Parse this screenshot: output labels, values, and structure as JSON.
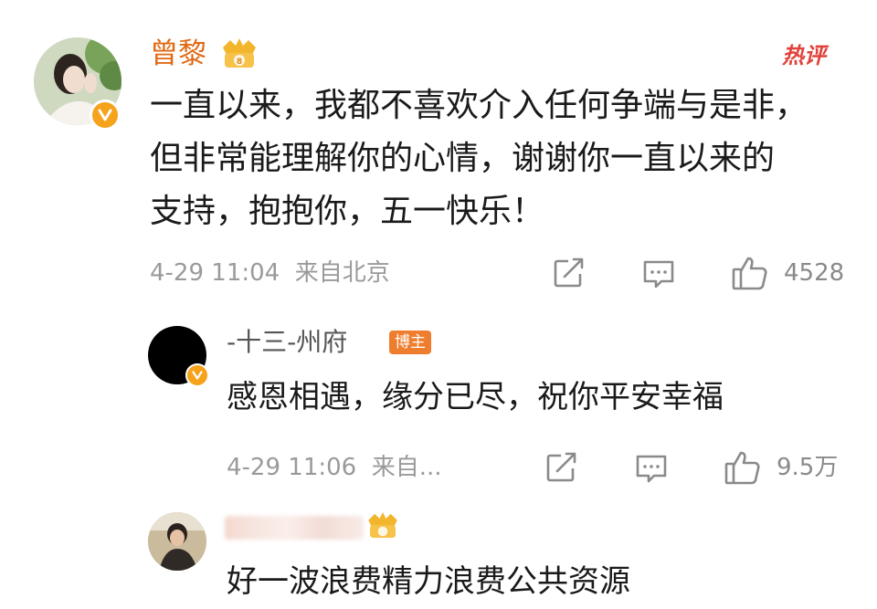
{
  "comment_main": {
    "username": "曾黎",
    "hot_label": "热评",
    "lines": [
      "一直以来，我都不喜欢介入任何争端与是非，",
      "但非常能理解你的心情，谢谢你一直以来的",
      "支持，抱抱你，五一快乐！"
    ],
    "meta": "4-29 11:04  来自北京",
    "like_count": "4528",
    "icons": {
      "share": "share-icon",
      "reply": "comment-icon",
      "like": "thumbs-up-icon",
      "vip": "vip-crown-icon",
      "verified": "verified-v-icon"
    }
  },
  "reply_1": {
    "username": "-十三-州府",
    "tag": "博主",
    "text": "感恩相遇，缘分已尽，祝你平安幸福",
    "meta": "4-29 11:06  来自...",
    "like_count": "9.5万"
  },
  "reply_2": {
    "text": "好一波浪费精力浪费公共资源"
  },
  "colors": {
    "username": "#e06a16",
    "meta": "#9a9a9a",
    "hot": "#e1423a",
    "blogger_tag": "#ef7d2e"
  }
}
